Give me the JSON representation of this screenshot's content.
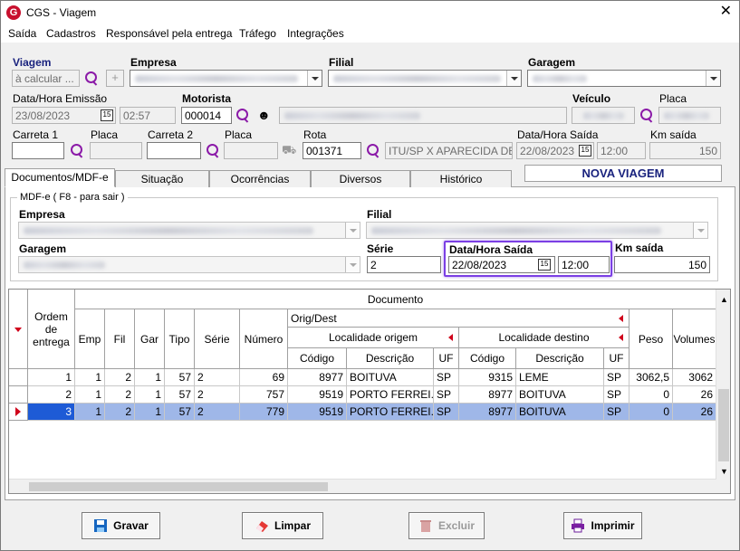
{
  "window": {
    "title": "CGS - Viagem",
    "close": "✕"
  },
  "menu": [
    "Saída",
    "Cadastros",
    "Responsável pela entrega",
    "Tráfego",
    "Integrações"
  ],
  "header": {
    "viagem_label": "Viagem",
    "viagem_value": "à calcular ...",
    "empresa_label": "Empresa",
    "filial_label": "Filial",
    "garagem_label": "Garagem",
    "data_emissao_label": "Data/Hora Emissão",
    "data_emissao": "23/08/2023",
    "hora_emissao": "02:57",
    "motorista_label": "Motorista",
    "motorista_code": "000014",
    "veiculo_label": "Veículo",
    "placa_label": "Placa",
    "carreta1_label": "Carreta 1",
    "placa1_label": "Placa",
    "carreta2_label": "Carreta 2",
    "placa2_label": "Placa",
    "rota_label": "Rota",
    "rota_code": "001371",
    "rota_desc": "ITU/SP X APARECIDA DE G",
    "data_saida_label": "Data/Hora Saída",
    "data_saida": "22/08/2023",
    "hora_saida": "12:00",
    "km_label": "Km saída",
    "km_value": "150"
  },
  "tabs": [
    "Documentos/MDF-e",
    "Situação",
    "Ocorrências",
    "Diversos",
    "Histórico"
  ],
  "status_banner": "NOVA VIAGEM",
  "mdfe": {
    "group_title": "MDF-e ( F8 - para sair )",
    "empresa_label": "Empresa",
    "filial_label": "Filial",
    "garagem_label": "Garagem",
    "serie_label": "Série",
    "serie_value": "2",
    "data_saida_label": "Data/Hora Saída",
    "data_saida": "22/08/2023",
    "hora_saida": "12:00",
    "km_label": "Km saída",
    "km_value": "150"
  },
  "grid": {
    "group_documento": "Documento",
    "group_origdest": "Orig/Dest",
    "group_origem": "Localidade origem",
    "group_destino": "Localidade destino",
    "col_ordem": "Ordem de entrega",
    "col_emp": "Emp",
    "col_fil": "Fil",
    "col_gar": "Gar",
    "col_tipo": "Tipo",
    "col_serie": "Série",
    "col_numero": "Número",
    "col_codigo": "Código",
    "col_descricao": "Descrição",
    "col_uf": "UF",
    "col_peso": "Peso",
    "col_volumes": "Volumes",
    "rows": [
      {
        "ordem": "1",
        "emp": "1",
        "fil": "2",
        "gar": "1",
        "tipo": "57",
        "serie": "2",
        "numero": "69",
        "cod_o": "8977",
        "desc_o": "BOITUVA",
        "uf_o": "SP",
        "cod_d": "9315",
        "desc_d": "LEME",
        "uf_d": "SP",
        "peso": "3062,5",
        "vol": "3062"
      },
      {
        "ordem": "2",
        "emp": "1",
        "fil": "2",
        "gar": "1",
        "tipo": "57",
        "serie": "2",
        "numero": "757",
        "cod_o": "9519",
        "desc_o": "PORTO FERREI...",
        "uf_o": "SP",
        "cod_d": "8977",
        "desc_d": "BOITUVA",
        "uf_d": "SP",
        "peso": "0",
        "vol": "26"
      },
      {
        "ordem": "3",
        "emp": "1",
        "fil": "2",
        "gar": "1",
        "tipo": "57",
        "serie": "2",
        "numero": "779",
        "cod_o": "9519",
        "desc_o": "PORTO FERREI...",
        "uf_o": "SP",
        "cod_d": "8977",
        "desc_d": "BOITUVA",
        "uf_d": "SP",
        "peso": "0",
        "vol": "26"
      }
    ]
  },
  "buttons": {
    "gravar": "Gravar",
    "limpar": "Limpar",
    "excluir": "Excluir",
    "imprimir": "Imprimir"
  },
  "colors": {
    "highlight": "#7b3fe4",
    "selected_row": "#9fb7e8",
    "search_icon": "#8b1aa8",
    "banner_text": "#1a237e"
  }
}
